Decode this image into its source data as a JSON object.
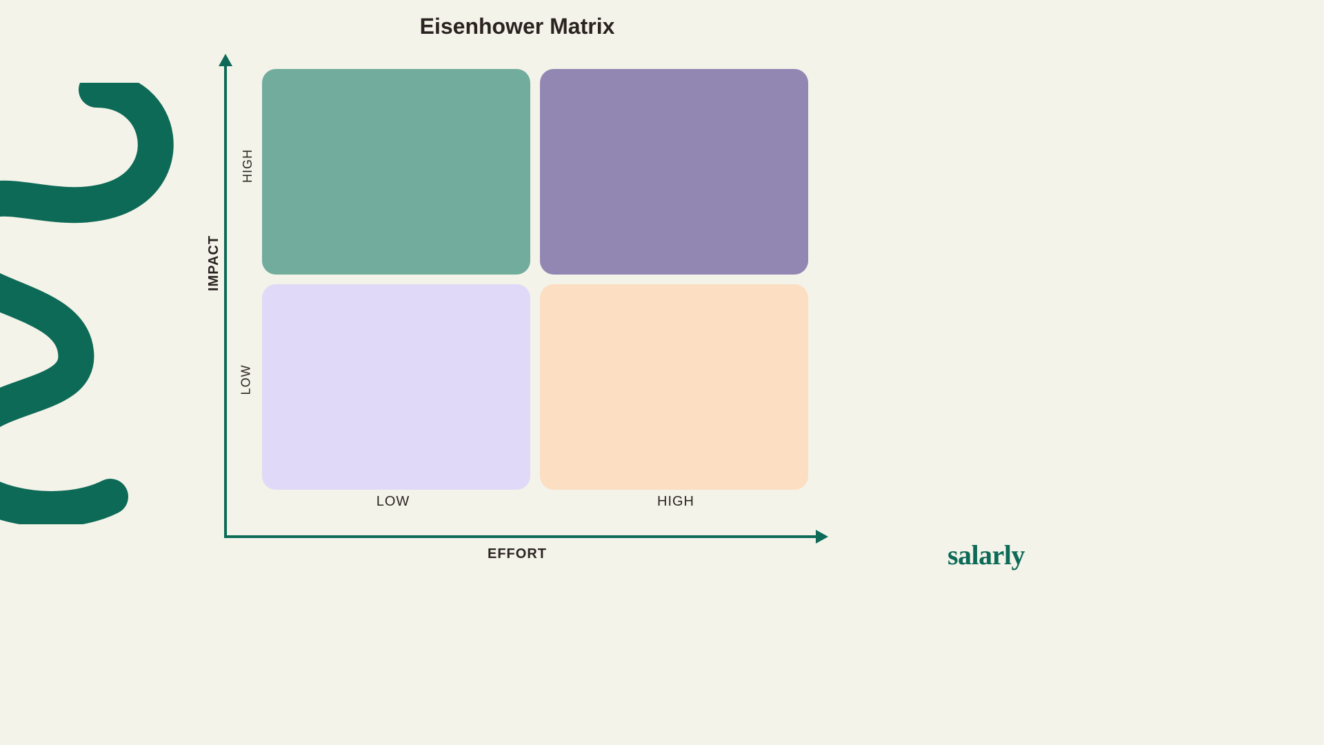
{
  "brand": "salarly",
  "colors": {
    "accent": "#0d6a57",
    "bg": "#f3f3e9",
    "q_tl": "#72ac9c",
    "q_tr": "#9286b3",
    "q_bl": "#e0d9f7",
    "q_br": "#fcdec2"
  },
  "chart_data": {
    "type": "heatmap",
    "title": "Eisenhower Matrix",
    "xlabel": "EFFORT",
    "ylabel": "IMPACT",
    "x_ticks": [
      "LOW",
      "HIGH"
    ],
    "y_ticks": [
      "LOW",
      "HIGH"
    ],
    "quadrants": [
      {
        "impact": "HIGH",
        "effort": "LOW",
        "color": "#72ac9c"
      },
      {
        "impact": "HIGH",
        "effort": "HIGH",
        "color": "#9286b3"
      },
      {
        "impact": "LOW",
        "effort": "LOW",
        "color": "#e0d9f7"
      },
      {
        "impact": "LOW",
        "effort": "HIGH",
        "color": "#fcdec2"
      }
    ]
  }
}
